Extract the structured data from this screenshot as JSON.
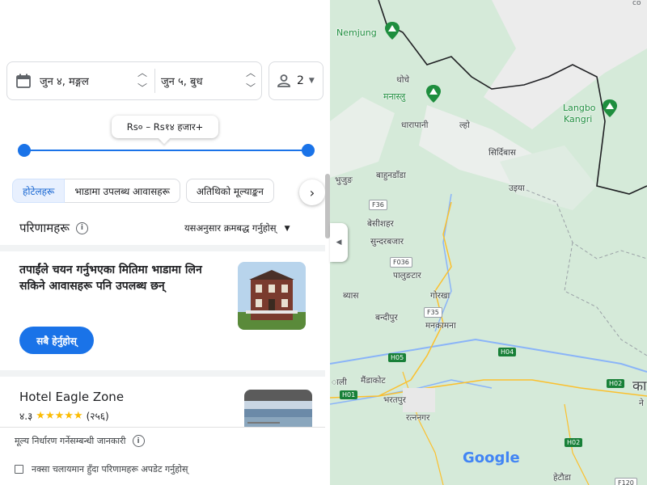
{
  "dates": {
    "checkin": "जुन ४, मङ्गल",
    "checkout": "जुन ५, बुध"
  },
  "guests": {
    "count": "2"
  },
  "price": {
    "range_label": "Rs० – Rs१४ हजार+",
    "min_fraction": 0,
    "max_fraction": 1
  },
  "tabs": [
    "होटेलहरू",
    "भाडामा उपलब्ध आवासहरू",
    "अतिथिको मूल्याङ्कन"
  ],
  "results": {
    "title": "परिणामहरू",
    "sort_label": "यसअनुसार क्रमबद्ध गर्नुहोस्"
  },
  "notice": {
    "text": "तपाईंले चयन गर्नुभएका मितिमा भाडामा लिन सकिने आवासहरू पनि उपलब्ध छन्",
    "button": "सबै हेर्नुहोस्"
  },
  "hotels": [
    {
      "name": "Hotel Eagle Zone",
      "rating": "४.३",
      "stars": "★★★★★",
      "reviews": "(२५६)"
    }
  ],
  "footer": {
    "pricing_info": "मूल्य निर्धारण गर्नेसम्बन्धी जानकारी",
    "map_update": "नक्सा चलायमान हुँदा परिणामहरू अपडेट गर्नुहोस्"
  },
  "map": {
    "labels": [
      "Nemjung",
      "थोचे",
      "मनास्लु",
      "Langbo",
      "Kangri",
      "धारापानी",
      "ल्हो",
      "सिर्दिबास",
      "बाहुनडाँडा",
      "भुजुङ",
      "उइया",
      "बेसीशहर",
      "सुन्दरबजार",
      "पालुङटार",
      "ब्यास",
      "गोरखा",
      "बन्दीपुर",
      "मनकामना",
      "मैंडाकोट",
      "भरतपुर",
      "रत्ननगर",
      "हेटौडा",
      "ाली",
      "का",
      "ने"
    ],
    "roads": [
      "F36",
      "F036",
      "F35",
      "H05",
      "H04",
      "H01",
      "H02",
      "H02",
      "F120"
    ],
    "logo": "Google",
    "copyright": "co"
  },
  "colors": {
    "accent": "#1a73e8",
    "star": "#fbbc04",
    "park": "#1e8e3e"
  }
}
